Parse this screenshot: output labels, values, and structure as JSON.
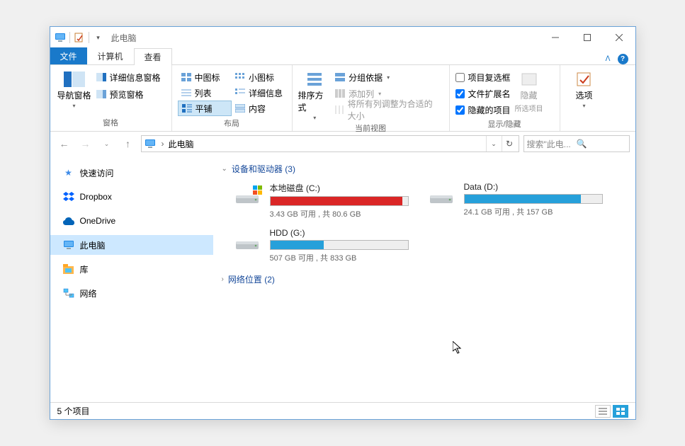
{
  "window": {
    "title": "此电脑"
  },
  "tabs": {
    "file": "文件",
    "items": [
      "计算机",
      "查看"
    ],
    "active_index": 1
  },
  "ribbon": {
    "groups": {
      "panes": {
        "label": "窗格",
        "nav": "导航窗格",
        "details_pane": "详细信息窗格",
        "preview": "预览窗格"
      },
      "layout": {
        "label": "布局",
        "medium_icons": "中图标",
        "small_icons": "小图标",
        "list": "列表",
        "details": "详细信息",
        "tiles": "平铺",
        "content": "内容"
      },
      "current_view": {
        "label": "当前视图",
        "sort": "排序方式",
        "group_by": "分组依据",
        "add_columns": "添加列",
        "size_columns": "将所有列调整为合适的大小"
      },
      "show_hide": {
        "label": "显示/隐藏",
        "item_checkboxes": "项目复选框",
        "file_ext": "文件扩展名",
        "hidden_items": "隐藏的项目",
        "hide": "隐藏",
        "hide_sub": "所选项目"
      },
      "options": {
        "label": "",
        "options": "选项"
      }
    }
  },
  "address": {
    "location": "此电脑"
  },
  "search": {
    "placeholder": "搜索\"此电..."
  },
  "sidebar": {
    "items": [
      {
        "label": "快速访问",
        "icon": "star"
      },
      {
        "label": "Dropbox",
        "icon": "dropbox"
      },
      {
        "label": "OneDrive",
        "icon": "onedrive"
      },
      {
        "label": "此电脑",
        "icon": "pc",
        "selected": true
      },
      {
        "label": "库",
        "icon": "library"
      },
      {
        "label": "网络",
        "icon": "network"
      }
    ]
  },
  "content": {
    "group_drives": {
      "label": "设备和驱动器",
      "count": 3
    },
    "group_network": {
      "label": "网络位置",
      "count": 2
    },
    "drives": [
      {
        "name": "本地磁盘 (C:)",
        "usage_text": "3.43 GB 可用 , 共 80.6 GB",
        "fill_pct": 96,
        "warn": true,
        "os": true
      },
      {
        "name": "Data (D:)",
        "usage_text": "24.1 GB 可用 , 共 157 GB",
        "fill_pct": 85,
        "warn": false,
        "os": false
      },
      {
        "name": "HDD (G:)",
        "usage_text": "507 GB 可用 , 共 833 GB",
        "fill_pct": 39,
        "warn": false,
        "os": false
      }
    ]
  },
  "status": {
    "items": "5 个项目"
  }
}
